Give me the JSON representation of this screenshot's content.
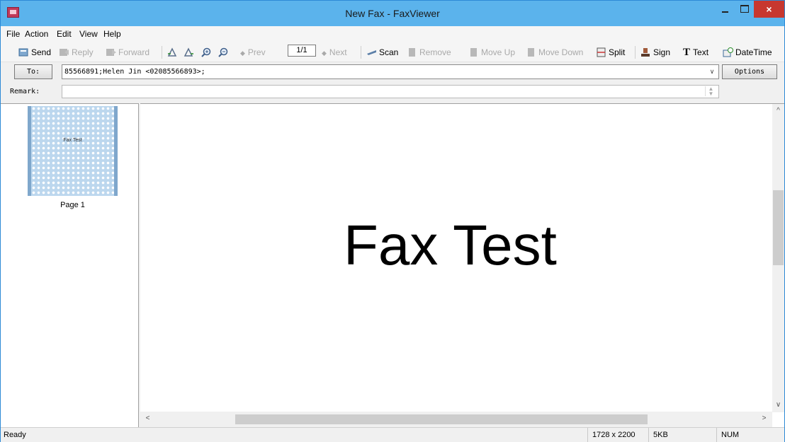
{
  "window": {
    "title": "New Fax - FaxViewer",
    "close_glyph": "×"
  },
  "menu": [
    "File",
    "Action",
    "Edit",
    "View",
    "Help"
  ],
  "toolbar": {
    "send": "Send",
    "reply": "Reply",
    "forward": "Forward",
    "prev": "Prev",
    "page": "1/1",
    "next": "Next",
    "scan": "Scan",
    "remove": "Remove",
    "move_up": "Move Up",
    "move_down": "Move Down",
    "split": "Split",
    "sign": "Sign",
    "text": "Text",
    "datetime": "DateTime"
  },
  "recipient": {
    "to_label": "To:",
    "to_value": "85566891;Helen Jin <02085566893>;",
    "options_label": "Options",
    "remark_label": "Remark:",
    "remark_value": ""
  },
  "thumbnail": {
    "label": "Page 1",
    "preview_text": "Fax Test"
  },
  "document": {
    "text": "Fax Test"
  },
  "status": {
    "state": "Ready",
    "dimensions": "1728 x 2200",
    "size": "5KB",
    "mode": "NUM"
  },
  "colors": {
    "titlebar": "#5bb3ec",
    "close_button": "#c7372f"
  }
}
